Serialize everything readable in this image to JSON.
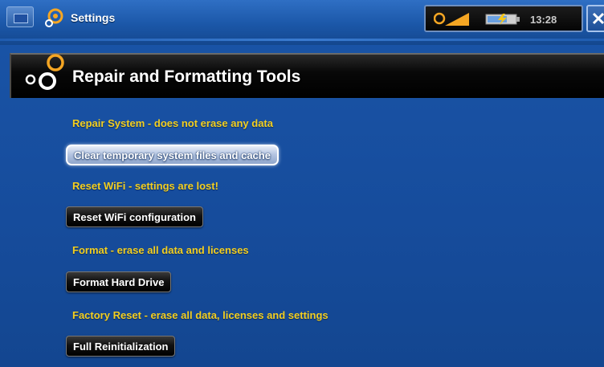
{
  "header": {
    "app_title": "Settings",
    "clock": "13:28",
    "section_title": "Repair and Formatting Tools"
  },
  "options": [
    {
      "description": "Repair System - does not erase any data",
      "button_label": "Clear temporary system files and cache",
      "selected": true
    },
    {
      "description": "Reset WiFi - settings are lost!",
      "button_label": "Reset WiFi configuration",
      "selected": false
    },
    {
      "description": "Format - erase all data and licenses",
      "button_label": "Format Hard Drive",
      "selected": false
    },
    {
      "description": "Factory Reset - erase all data, licenses and settings",
      "button_label": "Full Reinitialization",
      "selected": false
    }
  ],
  "icons": {
    "menu": "menu-icon",
    "app": "settings-gear-icon",
    "signal": "signal-strength-icon",
    "battery": "battery-icon",
    "close": "close-icon",
    "section": "gears-icon"
  },
  "colors": {
    "background": "#1a55a8",
    "description_text": "#f3cf21",
    "header_bar": "#000000",
    "button": "#000000",
    "selected_button": "#b6c6e2"
  }
}
